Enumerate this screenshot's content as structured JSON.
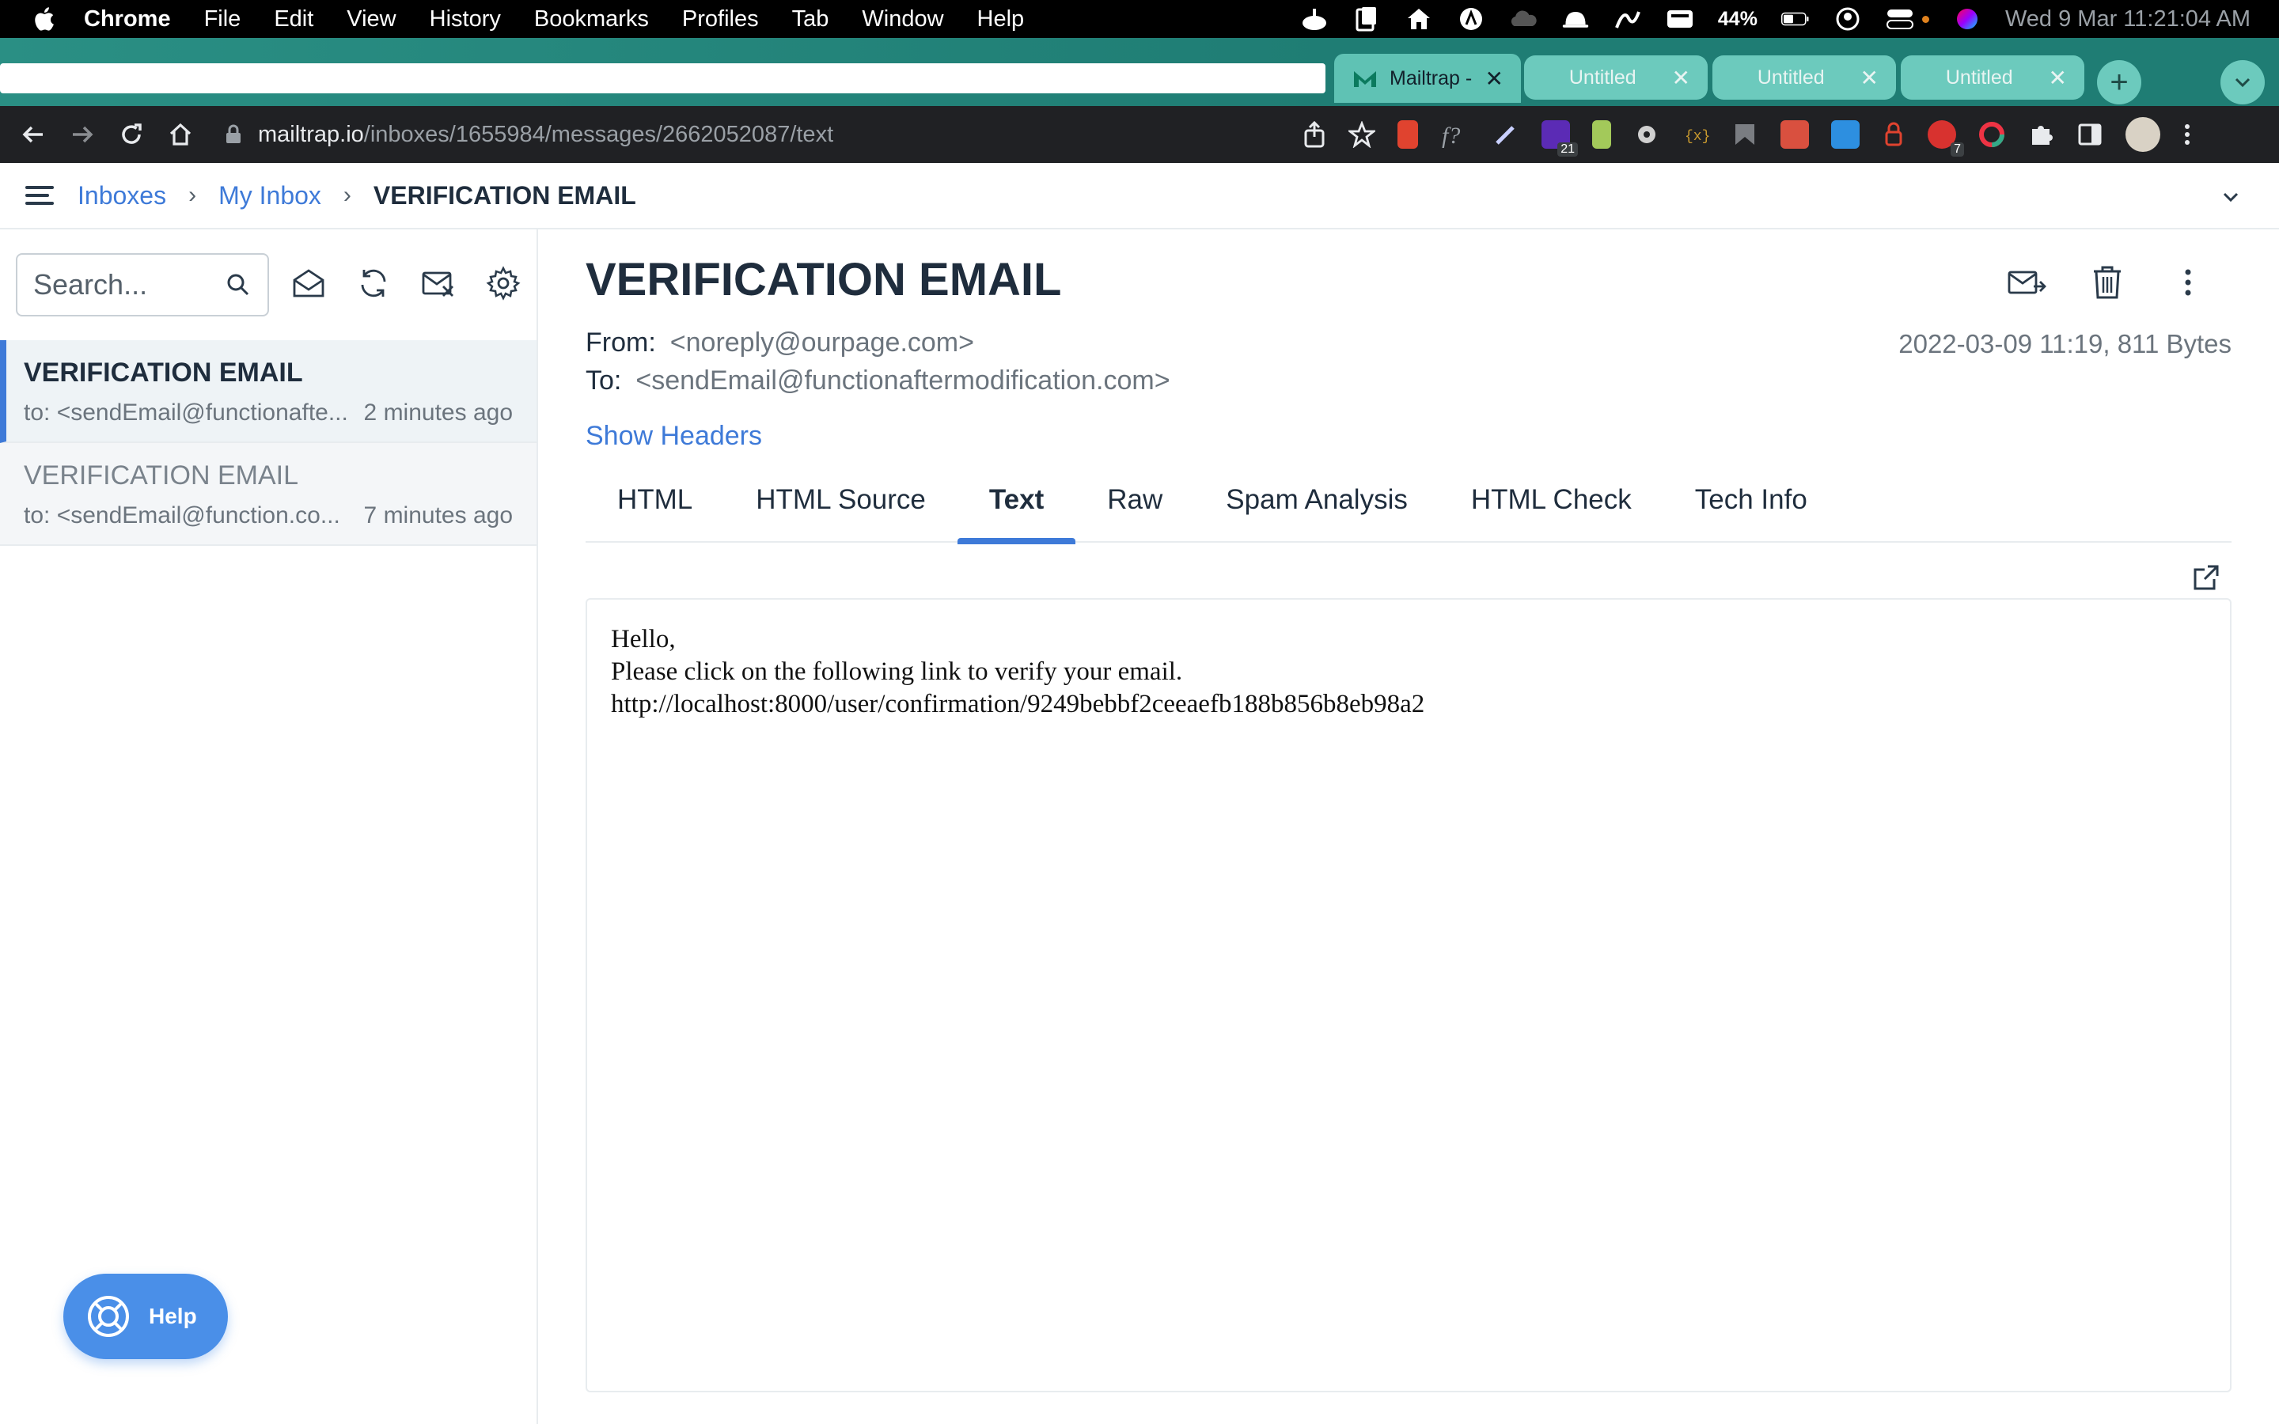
{
  "menubar": {
    "app": "Chrome",
    "items": [
      "File",
      "Edit",
      "View",
      "History",
      "Bookmarks",
      "Profiles",
      "Tab",
      "Window",
      "Help"
    ],
    "battery_pct": "44%",
    "clock": "Wed 9 Mar  11:21:04 AM"
  },
  "tabs": {
    "active": {
      "label": "Mailtrap -",
      "icon": "mailtrap-icon"
    },
    "others": [
      {
        "label": "Untitled"
      },
      {
        "label": "Untitled"
      },
      {
        "label": "Untitled"
      }
    ]
  },
  "toolbar": {
    "url_host": "mailtrap.io",
    "url_path": "/inboxes/1655984/messages/2662052087/text",
    "ext_badges": {
      "purple": "21",
      "abp": "7"
    }
  },
  "breadcrumb": {
    "items": [
      "Inboxes",
      "My Inbox"
    ],
    "current": "VERIFICATION EMAIL"
  },
  "sidebar": {
    "search_placeholder": "Search...",
    "messages": [
      {
        "subject": "VERIFICATION EMAIL",
        "to": "to: <sendEmail@functionafte...",
        "age": "2 minutes ago"
      },
      {
        "subject": "VERIFICATION EMAIL",
        "to": "to: <sendEmail@function.co...",
        "age": "7 minutes ago"
      }
    ],
    "help_label": "Help"
  },
  "message": {
    "title": "VERIFICATION EMAIL",
    "from_label": "From:",
    "from": "<noreply@ourpage.com>",
    "to_label": "To:",
    "to": "<sendEmail@functionaftermodification.com>",
    "date_info": "2022-03-09 11:19, 811 Bytes",
    "show_headers": "Show Headers",
    "tabs": [
      "HTML",
      "HTML Source",
      "Text",
      "Raw",
      "Spam Analysis",
      "HTML Check",
      "Tech Info"
    ],
    "active_tab": "Text",
    "body": "Hello,\nPlease click on the following link to verify your email.\nhttp://localhost:8000/user/confirmation/9249bebbf2ceeaefb188b856b8eb98a2"
  },
  "colors": {
    "accent": "#3e7ad8",
    "tabstrip": "#1f7d74",
    "help_button": "#4a8fe8"
  }
}
